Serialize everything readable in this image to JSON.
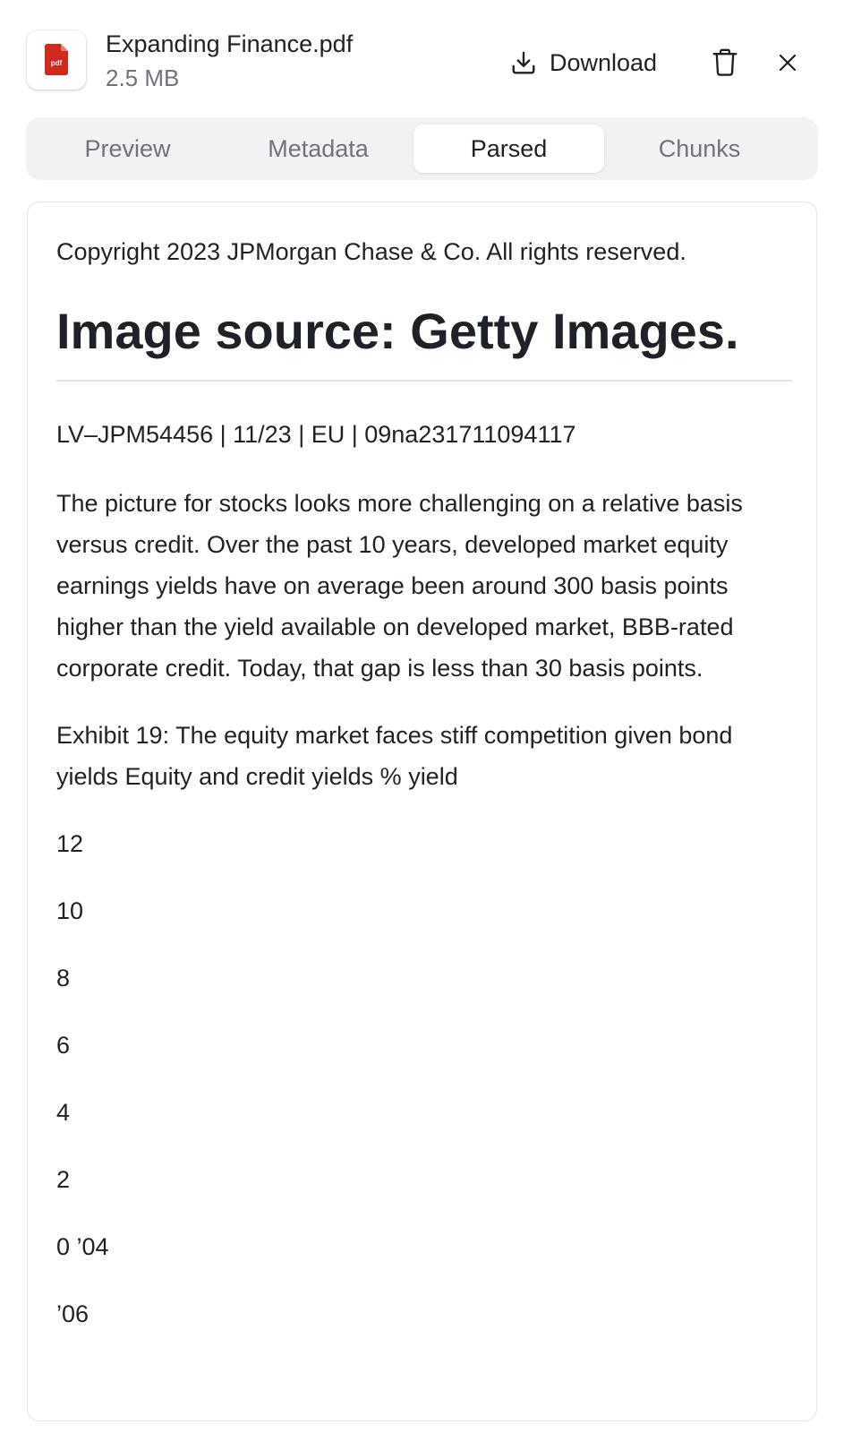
{
  "file": {
    "name": "Expanding Finance.pdf",
    "size": "2.5 MB",
    "icon_label": "pdf",
    "icon_color": "#d2291f"
  },
  "actions": {
    "download_label": "Download",
    "download_icon": "download-icon",
    "delete_icon": "trash-icon",
    "close_icon": "close-icon"
  },
  "tabs": [
    {
      "label": "Preview",
      "active": false
    },
    {
      "label": "Metadata",
      "active": false
    },
    {
      "label": "Parsed",
      "active": true
    },
    {
      "label": "Chunks",
      "active": false
    }
  ],
  "parsed": {
    "copyright": "Copyright 2023 JPMorgan Chase & Co. All rights reserved.",
    "heading": "Image source: Getty Images.",
    "meta_line": "LV–JPM54456 | 11/23 | EU | 09na231711094117",
    "paragraph": "The picture for stocks looks more challenging on a relative basis versus credit. Over the past 10 years, developed market equity earnings yields have on average been around 300 basis points higher than the yield available on developed market, BBB-rated corporate credit. Today, that gap is less than 30 basis points.",
    "exhibit": "Exhibit 19: The equity market faces stiff competition given bond yields Equity and credit yields % yield",
    "lines": [
      "12",
      "10",
      "8",
      "6",
      "4",
      "2",
      "0 ’04",
      "’06"
    ]
  }
}
